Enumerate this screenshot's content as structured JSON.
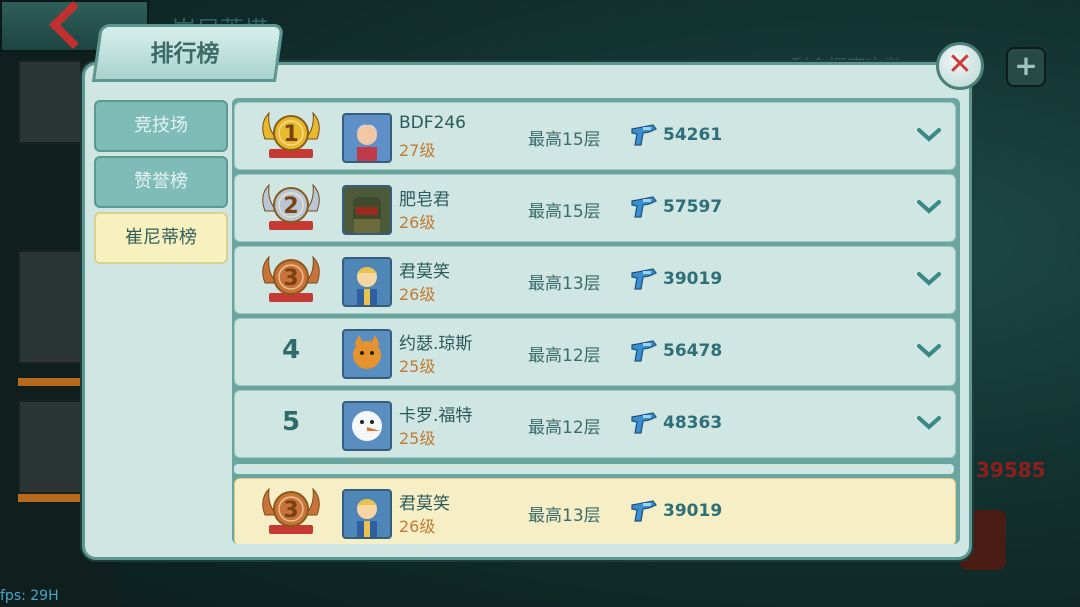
{
  "window": {
    "title": "排行榜",
    "bg_title": "崔尼蒂塔",
    "bg_label": "剩余探索次数",
    "bg_number": "39585",
    "fps": "fps: 29H"
  },
  "tabs": [
    {
      "label": "竞技场",
      "active": false
    },
    {
      "label": "赞誉榜",
      "active": false
    },
    {
      "label": "崔尼蒂榜",
      "active": true
    }
  ],
  "rows": [
    {
      "rank": "1",
      "medal": "gold",
      "name": "BDF246",
      "level": "27级",
      "floor": "最高15层",
      "power": "54261",
      "avatar": "woman-icon"
    },
    {
      "rank": "2",
      "medal": "silver",
      "name": "肥皂君",
      "level": "26级",
      "floor": "最高15层",
      "power": "57597",
      "avatar": "armored-soldier-icon"
    },
    {
      "rank": "3",
      "medal": "bronze",
      "name": "君莫笑",
      "level": "26级",
      "floor": "最高13层",
      "power": "39019",
      "avatar": "vault-boy-icon"
    },
    {
      "rank": "4",
      "medal": "none",
      "name": "约瑟.琼斯",
      "level": "25级",
      "floor": "最高12层",
      "power": "56478",
      "avatar": "cat-icon"
    },
    {
      "rank": "5",
      "medal": "none",
      "name": "卡罗.福特",
      "level": "25级",
      "floor": "最高12层",
      "power": "48363",
      "avatar": "snowman-icon"
    }
  ],
  "my_row": {
    "rank": "3",
    "medal": "bronze",
    "name": "君莫笑",
    "level": "26级",
    "floor": "最高13层",
    "power": "39019",
    "avatar": "vault-boy-icon"
  },
  "colors": {
    "gold": "#e8b92c",
    "silver": "#b8c6d6",
    "bronze": "#c9733a",
    "panel": "#cfe6e3",
    "accent": "#2e6f78"
  }
}
